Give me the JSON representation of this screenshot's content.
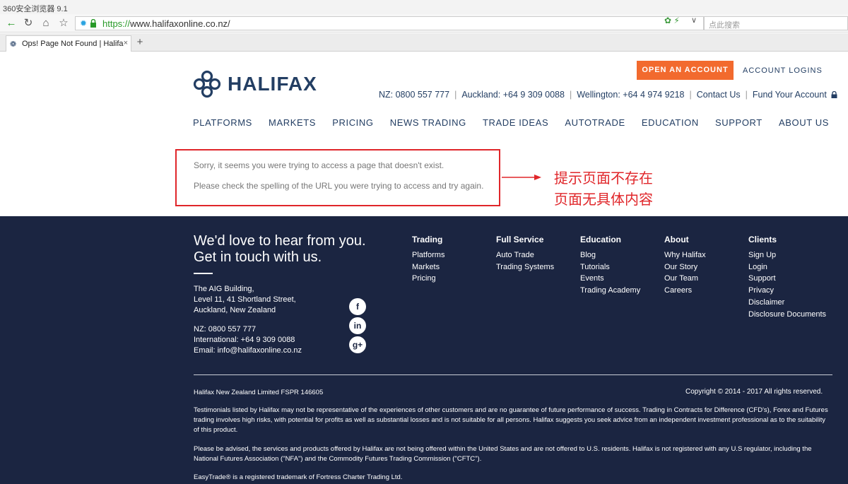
{
  "browser": {
    "app_title": "360安全浏览器 9.1",
    "url_scheme": "https://",
    "url_rest": "www.halifaxonline.co.nz/",
    "search_placeholder": "点此搜索",
    "tab_title": "Ops! Page Not Found | Halifa",
    "nav_icons": [
      "back-icon",
      "refresh-icon",
      "home-icon",
      "star-icon"
    ]
  },
  "header": {
    "logo_text": "HALIFAX",
    "open_account": "OPEN AN ACCOUNT",
    "account_logins": "ACCOUNT LOGINS",
    "contacts": [
      "NZ: 0800 557 777",
      "Auckland: +64 9 309 0088",
      "Wellington: +64 4 974 9218",
      "Contact Us",
      "Fund Your Account"
    ],
    "nav": [
      "PLATFORMS",
      "MARKETS",
      "PRICING",
      "NEWS TRADING",
      "TRADE IDEAS",
      "AUTOTRADE",
      "EDUCATION",
      "SUPPORT",
      "ABOUT US"
    ]
  },
  "error": {
    "line1": "Sorry, it seems you were trying to access a page that doesn't exist.",
    "line2": "Please check the spelling of the URL you were trying to access and try again."
  },
  "annotation": {
    "line1": "提示页面不存在",
    "line2": "页面无具体内容",
    "color": "#e0262a"
  },
  "footer": {
    "heading1": "We'd love to hear from you.",
    "heading2": "Get in touch with us.",
    "address": [
      "The AIG Building,",
      "Level 11, 41 Shortland Street,",
      "Auckland, New Zealand"
    ],
    "phones": [
      "NZ: 0800 557 777",
      "International: +64 9 309 0088",
      "Email: info@halifaxonline.co.nz"
    ],
    "social": [
      "f",
      "in",
      "g+"
    ],
    "columns": [
      {
        "title": "Trading",
        "links": [
          "Platforms",
          "Markets",
          "Pricing"
        ]
      },
      {
        "title": "Full Service",
        "links": [
          "Auto Trade",
          "Trading Systems"
        ]
      },
      {
        "title": "Education",
        "links": [
          "Blog",
          "Tutorials",
          "Events",
          "Trading Academy"
        ]
      },
      {
        "title": "About",
        "links": [
          "Why Halifax",
          "Our Story",
          "Our Team",
          "Careers"
        ]
      },
      {
        "title": "Clients",
        "links": [
          "Sign Up",
          "Login",
          "Support",
          "Privacy",
          "Disclaimer",
          "Disclosure Documents"
        ]
      }
    ],
    "company": "Halifax New Zealand Limited FSPR 146605",
    "copyright": "Copyright © 2014 - 2017 All rights reserved.",
    "disclaimer1": "Testimonials listed by Halifax may not be representative of the experiences of other customers and are no guarantee of future performance of success. Trading in Contracts for Difference (CFD's), Forex and Futures trading involves high risks, with potential for profits as well as substantial losses and is not suitable for all persons. Halifax suggests you seek advice from an independent investment professional as to the suitability of this product.",
    "disclaimer2": "Please be advised, the services and products offered by Halifax are not being offered within the United States and are not offered to U.S. residents. Halifax is not registered with any U.S regulator, including the National Futures Association (\"NFA\") and the Commodity Futures Trading Commission (\"CFTC\").",
    "trademark": "EasyTrade® is a registered trademark of Fortress Charter Trading Ltd."
  },
  "colors": {
    "brand_navy": "#233e63",
    "cta_orange": "#f26a2e",
    "footer_bg": "#1b2541"
  }
}
